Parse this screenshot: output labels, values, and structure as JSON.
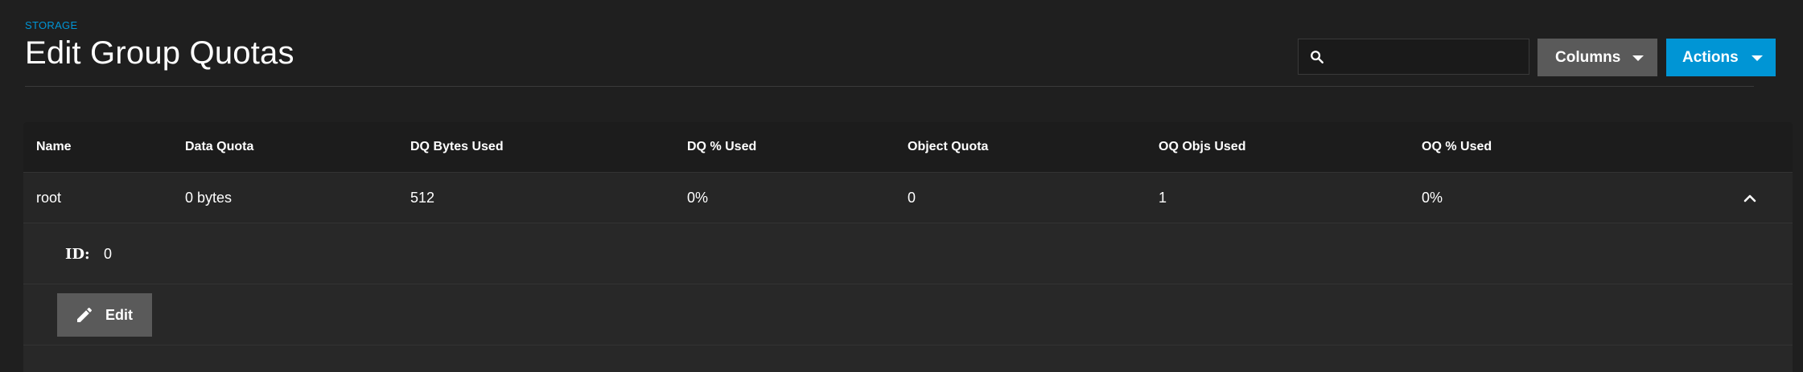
{
  "breadcrumb": "STORAGE",
  "page_title": "Edit Group Quotas",
  "search": {
    "placeholder": "",
    "value": "",
    "icon": "search-icon"
  },
  "toolbar": {
    "columns_label": "Columns",
    "actions_label": "Actions",
    "actions_color": "#0095d5",
    "columns_color": "#5a5a5a"
  },
  "table": {
    "columns": [
      "Name",
      "Data Quota",
      "DQ Bytes Used",
      "DQ % Used",
      "Object Quota",
      "OQ Objs Used",
      "OQ % Used"
    ],
    "rows": [
      {
        "name": "root",
        "data_quota": "0 bytes",
        "dq_bytes_used": "512",
        "dq_pct_used": "0%",
        "object_quota": "0",
        "oq_objs_used": "1",
        "oq_pct_used": "0%",
        "expanded": true
      }
    ]
  },
  "detail": {
    "id_label": "ID:",
    "id_value": "0",
    "edit_label": "Edit",
    "edit_icon": "pencil-icon"
  }
}
